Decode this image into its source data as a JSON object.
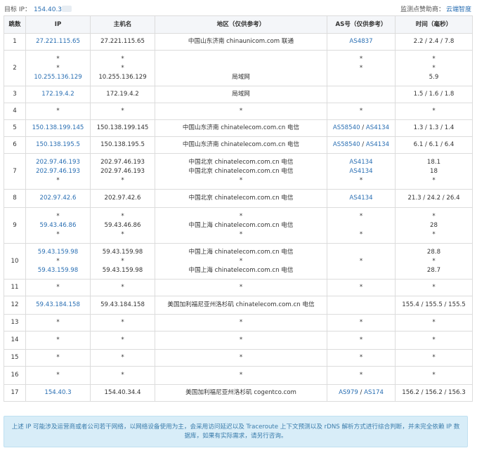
{
  "header": {
    "target_label": "目标 IP：",
    "target_ip": "154.40.3",
    "sponsor_label": "监测点赞助商：",
    "sponsor_name": "云端智度"
  },
  "table": {
    "columns": [
      "跳数",
      "IP",
      "主机名",
      "地区（仅供参考）",
      "AS号（仅供参考）",
      "时间（毫秒）"
    ],
    "rows": [
      {
        "hop": "1",
        "h": 24,
        "ip": [
          "27.221.115.65"
        ],
        "host": [
          "27.221.115.65"
        ],
        "region": [
          "中国山东济南 chinaunicom.com 联通"
        ],
        "as": [
          [
            [
              "AS4837"
            ]
          ]
        ],
        "time": [
          "2.2 / 2.4 / 7.8"
        ]
      },
      {
        "hop": "2",
        "h": 51,
        "ip": [
          "*",
          "*",
          "10.255.136.129"
        ],
        "host": [
          "*",
          "*",
          "10.255.136.129"
        ],
        "region": [
          "",
          "",
          "局域网"
        ],
        "as": [
          [
            [
              "*"
            ]
          ],
          [
            [
              "*"
            ]
          ],
          [
            [
              ""
            ]
          ]
        ],
        "time": [
          "*",
          "*",
          "5.9"
        ]
      },
      {
        "hop": "3",
        "h": 24,
        "ip": [
          "172.19.4.2"
        ],
        "host": [
          "172.19.4.2"
        ],
        "region": [
          "局域网"
        ],
        "as": [
          [
            [
              ""
            ]
          ]
        ],
        "time": [
          "1.5 / 1.6 / 1.8"
        ]
      },
      {
        "hop": "4",
        "h": 24,
        "ip": [
          "*"
        ],
        "host": [
          "*"
        ],
        "region": [
          "*"
        ],
        "as": [
          [
            [
              "*"
            ]
          ]
        ],
        "time": [
          "*"
        ]
      },
      {
        "hop": "5",
        "h": 24,
        "ip": [
          "150.138.199.145"
        ],
        "host": [
          "150.138.199.145"
        ],
        "region": [
          "中国山东济南 chinatelecom.com.cn 电信"
        ],
        "as": [
          [
            [
              "AS58540"
            ],
            [
              "AS4134"
            ]
          ]
        ],
        "time": [
          "1.3 / 1.3 / 1.4"
        ]
      },
      {
        "hop": "6",
        "h": 24,
        "ip": [
          "150.138.195.5"
        ],
        "host": [
          "150.138.195.5"
        ],
        "region": [
          "中国山东济南 chinatelecom.com.cn 电信"
        ],
        "as": [
          [
            [
              "AS58540"
            ],
            [
              "AS4134"
            ]
          ]
        ],
        "time": [
          "6.1 / 6.1 / 6.4"
        ]
      },
      {
        "hop": "7",
        "h": 51,
        "ip": [
          "202.97.46.193",
          "202.97.46.193",
          "*"
        ],
        "host": [
          "202.97.46.193",
          "202.97.46.193",
          "*"
        ],
        "region": [
          "中国北京 chinatelecom.com.cn 电信",
          "中国北京 chinatelecom.com.cn 电信",
          "*"
        ],
        "as": [
          [
            [
              "AS4134"
            ]
          ],
          [
            [
              "AS4134"
            ]
          ],
          [
            [
              "*"
            ]
          ]
        ],
        "time": [
          "18.1",
          "18",
          "*"
        ]
      },
      {
        "hop": "8",
        "h": 26,
        "ip": [
          "202.97.42.6"
        ],
        "host": [
          "202.97.42.6"
        ],
        "region": [
          "中国北京 chinatelecom.com.cn 电信"
        ],
        "as": [
          [
            [
              "AS4134"
            ]
          ]
        ],
        "time": [
          "21.3 / 24.2 / 26.4"
        ]
      },
      {
        "hop": "9",
        "h": 51,
        "ip": [
          "*",
          "59.43.46.86",
          "*"
        ],
        "host": [
          "*",
          "59.43.46.86",
          "*"
        ],
        "region": [
          "*",
          "中国上海 chinatelecom.com.cn 电信",
          "*"
        ],
        "as": [
          [
            [
              "*"
            ]
          ],
          [
            [
              ""
            ]
          ],
          [
            [
              "*"
            ]
          ]
        ],
        "time": [
          "*",
          "28",
          "*"
        ]
      },
      {
        "hop": "10",
        "h": 51,
        "ip": [
          "59.43.159.98",
          "*",
          "59.43.159.98"
        ],
        "host": [
          "59.43.159.98",
          "*",
          "59.43.159.98"
        ],
        "region": [
          "中国上海 chinatelecom.com.cn 电信",
          "*",
          "中国上海 chinatelecom.com.cn 电信"
        ],
        "as": [
          [
            [
              ""
            ]
          ],
          [
            [
              "*"
            ]
          ],
          [
            [
              ""
            ]
          ]
        ],
        "time": [
          "28.8",
          "*",
          "28.7"
        ]
      },
      {
        "hop": "11",
        "h": 24,
        "ip": [
          "*"
        ],
        "host": [
          "*"
        ],
        "region": [
          "*"
        ],
        "as": [
          [
            [
              "*"
            ]
          ]
        ],
        "time": [
          "*"
        ]
      },
      {
        "hop": "12",
        "h": 26,
        "ip": [
          "59.43.184.158"
        ],
        "host": [
          "59.43.184.158"
        ],
        "region": [
          "美国加利福尼亚州洛杉矶 chinatelecom.com.cn 电信"
        ],
        "as": [
          [
            [
              ""
            ]
          ]
        ],
        "time": [
          "155.4 / 155.5 / 155.5"
        ]
      },
      {
        "hop": "13",
        "h": 24,
        "ip": [
          "*"
        ],
        "host": [
          "*"
        ],
        "region": [
          "*"
        ],
        "as": [
          [
            [
              "*"
            ]
          ]
        ],
        "time": [
          "*"
        ]
      },
      {
        "hop": "14",
        "h": 26,
        "ip": [
          "*"
        ],
        "host": [
          "*"
        ],
        "region": [
          "*"
        ],
        "as": [
          [
            [
              "*"
            ]
          ]
        ],
        "time": [
          "*"
        ]
      },
      {
        "hop": "15",
        "h": 24,
        "ip": [
          "*"
        ],
        "host": [
          "*"
        ],
        "region": [
          "*"
        ],
        "as": [
          [
            [
              "*"
            ]
          ]
        ],
        "time": [
          "*"
        ]
      },
      {
        "hop": "16",
        "h": 26,
        "ip": [
          "*"
        ],
        "host": [
          "*"
        ],
        "region": [
          "*"
        ],
        "as": [
          [
            [
              "*"
            ]
          ]
        ],
        "time": [
          "*"
        ]
      },
      {
        "hop": "17",
        "h": 24,
        "ip": [
          "154.40.3"
        ],
        "host": [
          "154.40.34.4"
        ],
        "region": [
          "美国加利福尼亚州洛杉矶 cogentco.com"
        ],
        "as": [
          [
            [
              "AS979"
            ],
            [
              "AS174"
            ]
          ]
        ],
        "time": [
          "156.2 / 156.2 / 156.3"
        ]
      }
    ]
  },
  "notice": {
    "text": "上述 IP 可能涉及运营商或者公司若干网络，以网络设备使用为主，会采用访问延迟以及 Traceroute 上下文预测以及 rDNS 解析方式进行综合判断，并未完全依赖 IP 数据库，如果有实际需求，请另行咨询。"
  },
  "colors": {
    "link": "#2a6fb3",
    "header_bg": "#f4f6f9",
    "border": "#dcdcdc",
    "notice_bg": "#d8edf8",
    "notice_text": "#3a7cab"
  }
}
